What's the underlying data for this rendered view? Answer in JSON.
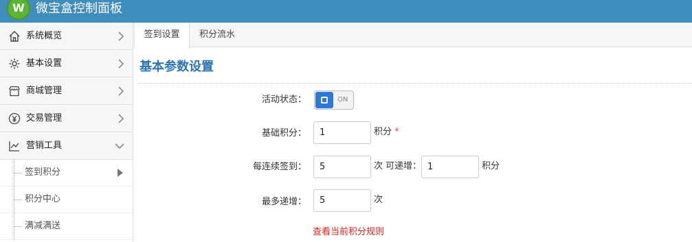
{
  "app": {
    "logo_text": "W",
    "title": "微宝盒控制面板"
  },
  "sidebar": {
    "items": [
      {
        "label": "系统概览",
        "icon": "home-icon",
        "expanded": false
      },
      {
        "label": "基本设置",
        "icon": "gear-icon",
        "expanded": false
      },
      {
        "label": "商城管理",
        "icon": "store-icon",
        "expanded": false
      },
      {
        "label": "交易管理",
        "icon": "yen-icon",
        "expanded": false
      },
      {
        "label": "营销工具",
        "icon": "chart-icon",
        "expanded": true
      }
    ],
    "subitems": [
      {
        "label": "签到积分",
        "active": true
      },
      {
        "label": "积分中心",
        "active": false
      },
      {
        "label": "满减满送",
        "active": false
      }
    ]
  },
  "tabs": [
    {
      "label": "签到设置",
      "active": true
    },
    {
      "label": "积分流水",
      "active": false
    }
  ],
  "section": {
    "title": "基本参数设置"
  },
  "form": {
    "status_label": "活动状态：",
    "status_switch_text": "ON",
    "base_points_label": "基础积分：",
    "base_points_value": "1",
    "base_points_unit": "积分",
    "required_mark": "*",
    "streak_label": "每连续签到：",
    "streak_value": "5",
    "streak_unit": "次",
    "increment_label": "可递增：",
    "increment_value": "1",
    "increment_unit": "积分",
    "max_label": "最多递增：",
    "max_value": "5",
    "max_unit": "次"
  },
  "rule_link": "查看当前积分规则",
  "colors": {
    "topbar": "#3e8dbc",
    "accent": "#2e75b5",
    "switch": "#2d7ad6",
    "link": "#d9251d"
  }
}
